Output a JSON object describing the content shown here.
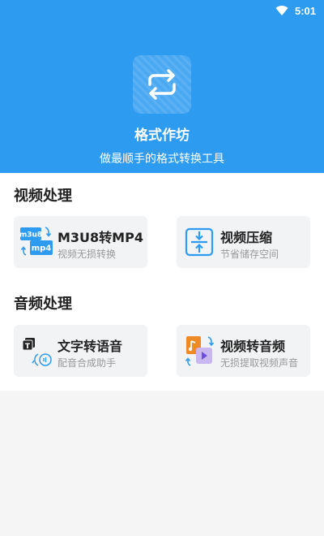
{
  "status_bar": {
    "time": "5:01",
    "wifi_icon": "wifi-icon"
  },
  "header": {
    "logo_icon": "repeat-arrows-icon",
    "title": "格式作坊",
    "subtitle": "做最顺手的格式转换工具",
    "background_color": "#2d9bf0"
  },
  "sections": [
    {
      "title": "视频处理",
      "cards": [
        {
          "title": "M3U8转MP4",
          "desc": "视频无损转换",
          "icon": "m3u8-to-mp4-icon",
          "icon_text_a": "m3u8",
          "icon_text_b": "mp4"
        },
        {
          "title": "视频压缩",
          "desc": "节省储存空间",
          "icon": "compress-icon"
        }
      ]
    },
    {
      "title": "音频处理",
      "cards": [
        {
          "title": "文字转语音",
          "desc": "配音合成助手",
          "icon": "text-to-speech-icon",
          "icon_text": "T"
        },
        {
          "title": "视频转音频",
          "desc": "无损提取视频声音",
          "icon": "video-to-audio-icon"
        }
      ]
    }
  ]
}
